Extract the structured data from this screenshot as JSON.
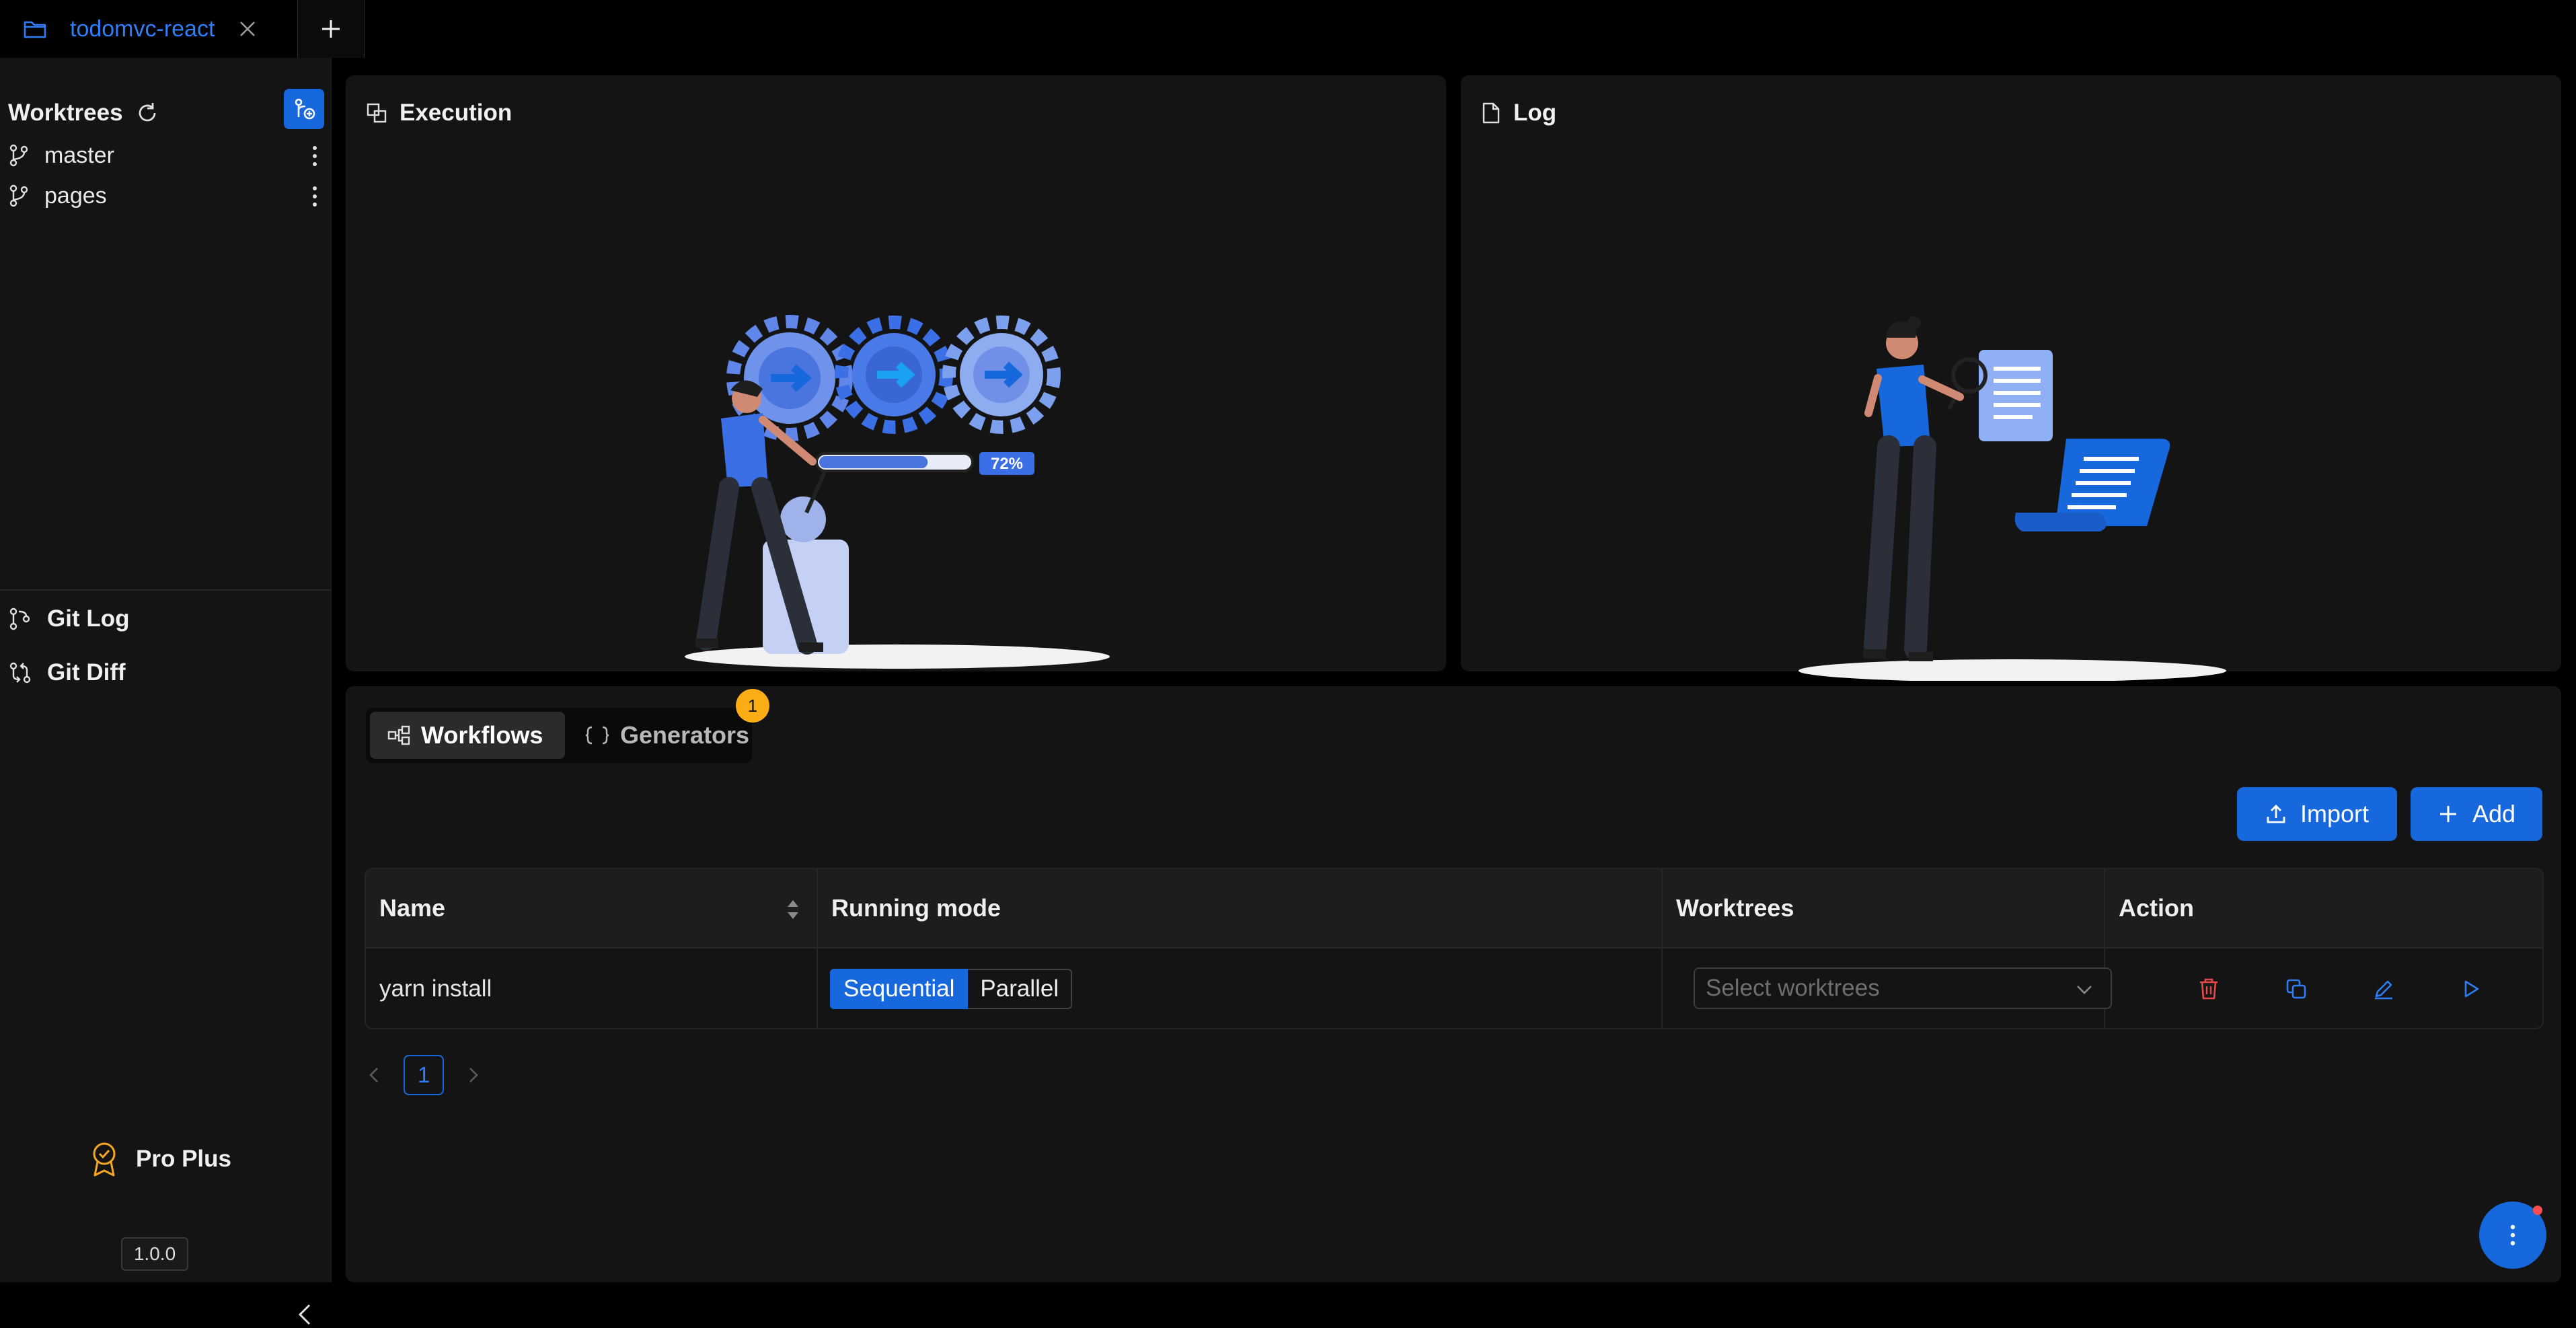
{
  "tabs": [
    {
      "label": "todomvc-react",
      "active": true
    }
  ],
  "sidebar": {
    "worktrees_title": "Worktrees",
    "worktrees": [
      {
        "label": "master"
      },
      {
        "label": "pages"
      }
    ],
    "nav": [
      {
        "label": "Git Log"
      },
      {
        "label": "Git Diff"
      }
    ],
    "plan_label": "Pro Plus",
    "version": "1.0.0"
  },
  "panels": {
    "execution": {
      "title": "Execution",
      "illustration_progress_text": "72%",
      "illustration_progress": 0.72
    },
    "log": {
      "title": "Log"
    }
  },
  "workflows": {
    "tabs": [
      {
        "label": "Workflows",
        "active": true
      },
      {
        "label": "Generators",
        "active": false,
        "badge": "1"
      }
    ],
    "import_label": "Import",
    "add_label": "Add",
    "columns": [
      "Name",
      "Running mode",
      "Worktrees",
      "Action"
    ],
    "rows": [
      {
        "name": "yarn install",
        "mode_options": [
          "Sequential",
          "Parallel"
        ],
        "mode_selected": "Sequential",
        "worktrees_placeholder": "Select worktrees"
      }
    ],
    "pagination": {
      "current": "1"
    }
  },
  "colors": {
    "accent": "#1668dc",
    "badge": "#faad14",
    "danger": "#e5484d",
    "background": "#000000",
    "panel": "#141414"
  }
}
